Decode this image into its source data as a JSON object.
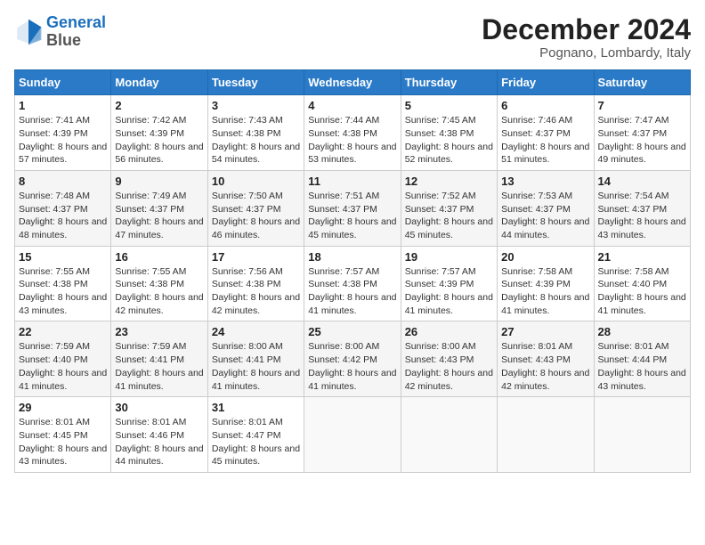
{
  "header": {
    "logo_line1": "General",
    "logo_line2": "Blue",
    "month": "December 2024",
    "location": "Pognano, Lombardy, Italy"
  },
  "weekdays": [
    "Sunday",
    "Monday",
    "Tuesday",
    "Wednesday",
    "Thursday",
    "Friday",
    "Saturday"
  ],
  "weeks": [
    [
      {
        "day": "1",
        "info": "Sunrise: 7:41 AM\nSunset: 4:39 PM\nDaylight: 8 hours and 57 minutes."
      },
      {
        "day": "2",
        "info": "Sunrise: 7:42 AM\nSunset: 4:39 PM\nDaylight: 8 hours and 56 minutes."
      },
      {
        "day": "3",
        "info": "Sunrise: 7:43 AM\nSunset: 4:38 PM\nDaylight: 8 hours and 54 minutes."
      },
      {
        "day": "4",
        "info": "Sunrise: 7:44 AM\nSunset: 4:38 PM\nDaylight: 8 hours and 53 minutes."
      },
      {
        "day": "5",
        "info": "Sunrise: 7:45 AM\nSunset: 4:38 PM\nDaylight: 8 hours and 52 minutes."
      },
      {
        "day": "6",
        "info": "Sunrise: 7:46 AM\nSunset: 4:37 PM\nDaylight: 8 hours and 51 minutes."
      },
      {
        "day": "7",
        "info": "Sunrise: 7:47 AM\nSunset: 4:37 PM\nDaylight: 8 hours and 49 minutes."
      }
    ],
    [
      {
        "day": "8",
        "info": "Sunrise: 7:48 AM\nSunset: 4:37 PM\nDaylight: 8 hours and 48 minutes."
      },
      {
        "day": "9",
        "info": "Sunrise: 7:49 AM\nSunset: 4:37 PM\nDaylight: 8 hours and 47 minutes."
      },
      {
        "day": "10",
        "info": "Sunrise: 7:50 AM\nSunset: 4:37 PM\nDaylight: 8 hours and 46 minutes."
      },
      {
        "day": "11",
        "info": "Sunrise: 7:51 AM\nSunset: 4:37 PM\nDaylight: 8 hours and 45 minutes."
      },
      {
        "day": "12",
        "info": "Sunrise: 7:52 AM\nSunset: 4:37 PM\nDaylight: 8 hours and 45 minutes."
      },
      {
        "day": "13",
        "info": "Sunrise: 7:53 AM\nSunset: 4:37 PM\nDaylight: 8 hours and 44 minutes."
      },
      {
        "day": "14",
        "info": "Sunrise: 7:54 AM\nSunset: 4:37 PM\nDaylight: 8 hours and 43 minutes."
      }
    ],
    [
      {
        "day": "15",
        "info": "Sunrise: 7:55 AM\nSunset: 4:38 PM\nDaylight: 8 hours and 43 minutes."
      },
      {
        "day": "16",
        "info": "Sunrise: 7:55 AM\nSunset: 4:38 PM\nDaylight: 8 hours and 42 minutes."
      },
      {
        "day": "17",
        "info": "Sunrise: 7:56 AM\nSunset: 4:38 PM\nDaylight: 8 hours and 42 minutes."
      },
      {
        "day": "18",
        "info": "Sunrise: 7:57 AM\nSunset: 4:38 PM\nDaylight: 8 hours and 41 minutes."
      },
      {
        "day": "19",
        "info": "Sunrise: 7:57 AM\nSunset: 4:39 PM\nDaylight: 8 hours and 41 minutes."
      },
      {
        "day": "20",
        "info": "Sunrise: 7:58 AM\nSunset: 4:39 PM\nDaylight: 8 hours and 41 minutes."
      },
      {
        "day": "21",
        "info": "Sunrise: 7:58 AM\nSunset: 4:40 PM\nDaylight: 8 hours and 41 minutes."
      }
    ],
    [
      {
        "day": "22",
        "info": "Sunrise: 7:59 AM\nSunset: 4:40 PM\nDaylight: 8 hours and 41 minutes."
      },
      {
        "day": "23",
        "info": "Sunrise: 7:59 AM\nSunset: 4:41 PM\nDaylight: 8 hours and 41 minutes."
      },
      {
        "day": "24",
        "info": "Sunrise: 8:00 AM\nSunset: 4:41 PM\nDaylight: 8 hours and 41 minutes."
      },
      {
        "day": "25",
        "info": "Sunrise: 8:00 AM\nSunset: 4:42 PM\nDaylight: 8 hours and 41 minutes."
      },
      {
        "day": "26",
        "info": "Sunrise: 8:00 AM\nSunset: 4:43 PM\nDaylight: 8 hours and 42 minutes."
      },
      {
        "day": "27",
        "info": "Sunrise: 8:01 AM\nSunset: 4:43 PM\nDaylight: 8 hours and 42 minutes."
      },
      {
        "day": "28",
        "info": "Sunrise: 8:01 AM\nSunset: 4:44 PM\nDaylight: 8 hours and 43 minutes."
      }
    ],
    [
      {
        "day": "29",
        "info": "Sunrise: 8:01 AM\nSunset: 4:45 PM\nDaylight: 8 hours and 43 minutes."
      },
      {
        "day": "30",
        "info": "Sunrise: 8:01 AM\nSunset: 4:46 PM\nDaylight: 8 hours and 44 minutes."
      },
      {
        "day": "31",
        "info": "Sunrise: 8:01 AM\nSunset: 4:47 PM\nDaylight: 8 hours and 45 minutes."
      },
      null,
      null,
      null,
      null
    ]
  ]
}
